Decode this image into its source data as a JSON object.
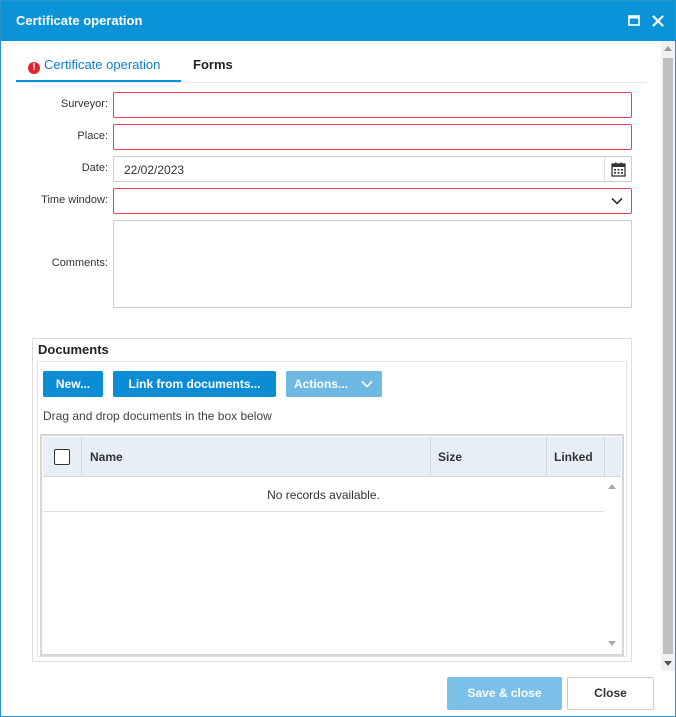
{
  "window": {
    "title": "Certificate operation",
    "titlebar_color": "#0b93d8"
  },
  "tabs": [
    {
      "label": "Certificate operation",
      "active": true,
      "has_error": true
    },
    {
      "label": "Forms",
      "active": false
    }
  ],
  "form": {
    "surveyor_label": "Surveyor:",
    "surveyor_value": "",
    "place_label": "Place:",
    "place_value": "",
    "date_label": "Date:",
    "date_value": "22/02/2023",
    "time_window_label": "Time window:",
    "time_window_value": "",
    "comments_label": "Comments:",
    "comments_value": ""
  },
  "documents": {
    "title": "Documents",
    "new_button": "New...",
    "link_button": "Link from documents...",
    "actions_button": "Actions...",
    "drag_hint": "Drag and drop documents in the box below",
    "columns": [
      "Name",
      "Size",
      "Linked"
    ],
    "empty_message": "No records available."
  },
  "footer": {
    "save_label": "Save & close",
    "close_label": "Close"
  },
  "colors": {
    "accent": "#0b93d8",
    "error": "#e0242b",
    "disabled_button": "#7bc0e8"
  }
}
